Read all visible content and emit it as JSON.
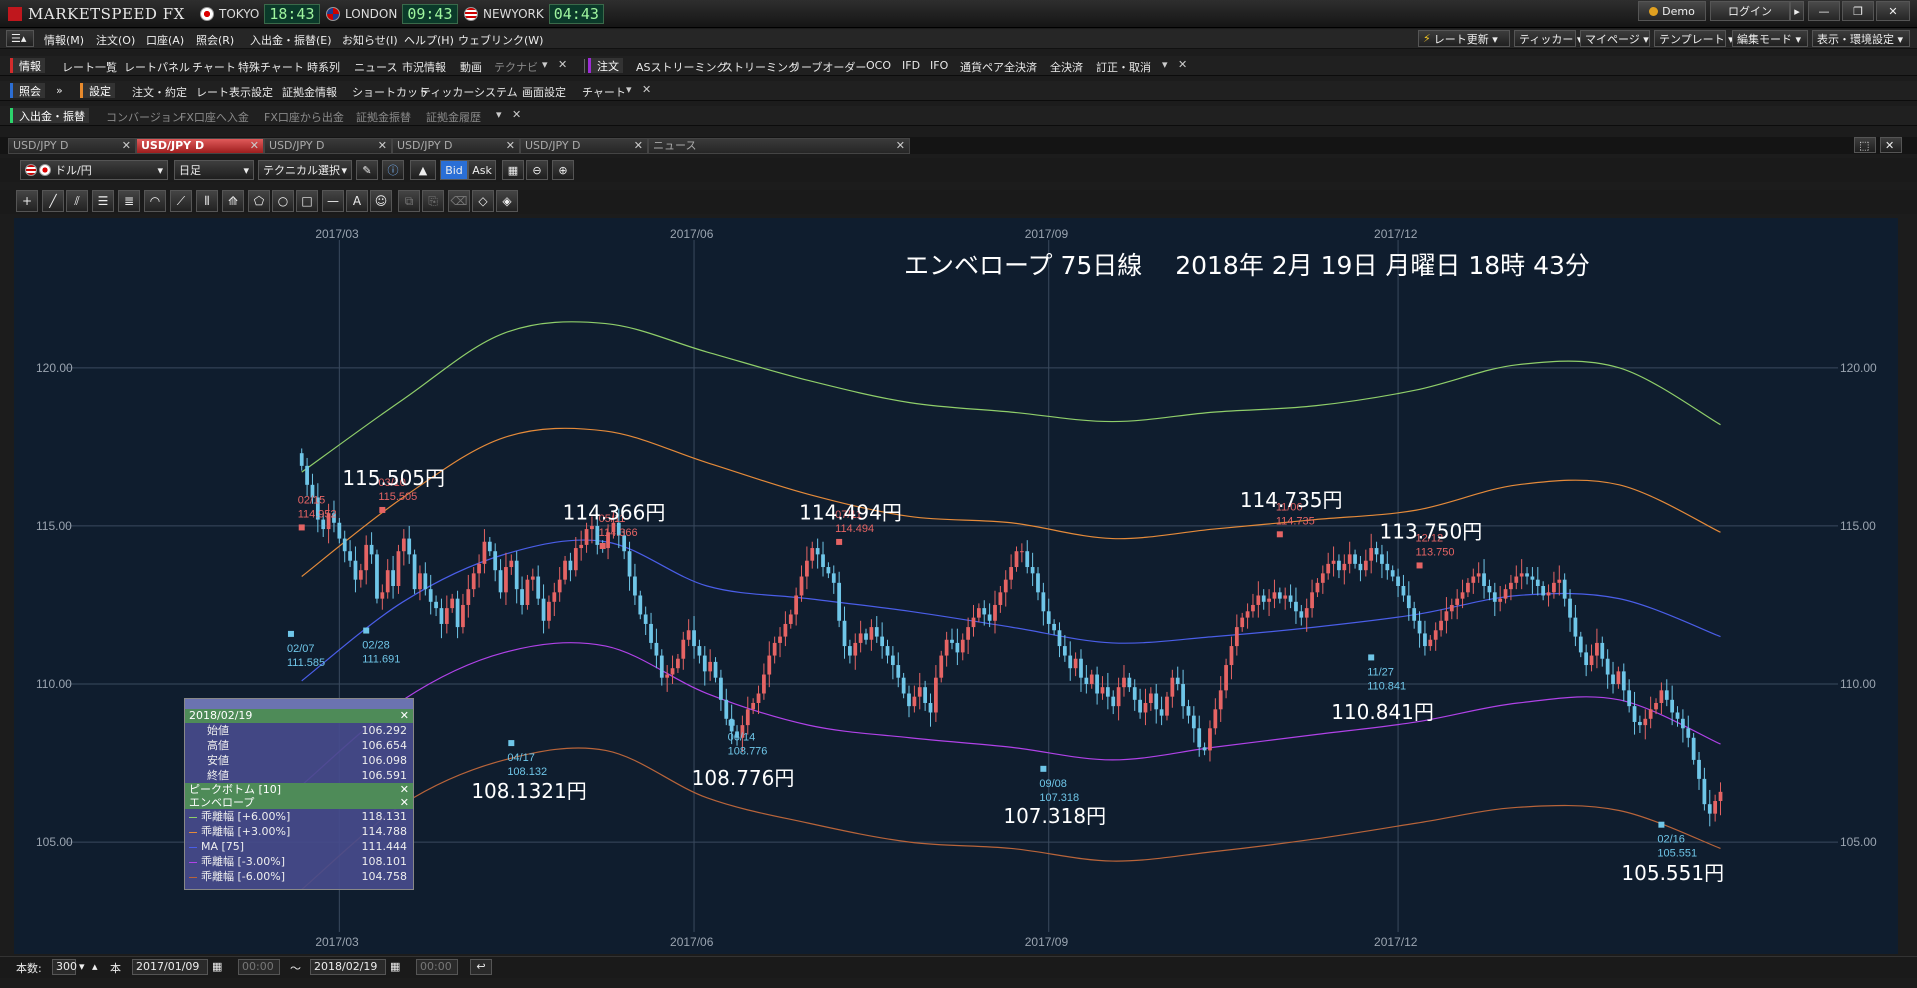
{
  "app": {
    "title": "MARKETSPEED FX"
  },
  "clocks": [
    {
      "city": "TOKYO",
      "time": "18:43"
    },
    {
      "city": "LONDON",
      "time": "09:43"
    },
    {
      "city": "NEWYORK",
      "time": "04:43"
    }
  ],
  "window_buttons": {
    "demo": "Demo",
    "login": "ログイン",
    "arrow": "▸",
    "minimize": "—",
    "restore": "❐",
    "close": "✕"
  },
  "menu": {
    "items": [
      "情報(M)",
      "注文(O)",
      "口座(A)",
      "照会(R)",
      "入出金・振替(E)",
      "お知らせ(I)",
      "ヘルプ(H)",
      "ウェブリンク(W)"
    ],
    "right": [
      "レート更新 ▾",
      "ティッカー ▾",
      "マイページ ▾",
      "テンプレート ▾",
      "編集モード ▾",
      "表示・環境設定 ▾"
    ]
  },
  "toolbar_info": {
    "tag": "情報",
    "items": [
      "レート一覧",
      "レートパネル",
      "チャート",
      "特殊チャート",
      "時系列",
      "ニュース",
      "市況情報",
      "動画",
      "テクナビ"
    ]
  },
  "toolbar_order": {
    "tag": "注文",
    "items": [
      "ASストリーミング",
      "ストリーミング",
      "リーブオーダー",
      "OCO",
      "IFD",
      "IFO",
      "通貨ペア全決済",
      "全決済",
      "訂正・取消"
    ]
  },
  "toolbar_inquiry": {
    "tag": "照会"
  },
  "toolbar_settings": {
    "tag": "設定",
    "items": [
      "注文・約定",
      "レート表示設定",
      "証拠金情報",
      "ショートカット",
      "ティッカー",
      "システム",
      "画面設定",
      "チャート"
    ]
  },
  "toolbar_deposit": {
    "tag": "入出金・振替",
    "items": [
      "コンバージョン",
      "FX口座へ入金",
      "FX口座から出金",
      "証拠金振替",
      "証拠金履歴"
    ]
  },
  "tabs": [
    "USD/JPY D",
    "USD/JPY D",
    "USD/JPY D",
    "USD/JPY D",
    "USD/JPY D",
    "ニュース"
  ],
  "chart_toolbar": {
    "pair": "ドル/円",
    "period": "日足",
    "technical": "テクニカル選択",
    "bid": "Bid",
    "ask": "Ask"
  },
  "info_panel": {
    "date": "2018/02/19",
    "ohlc": [
      {
        "label": "始値",
        "value": "106.292"
      },
      {
        "label": "高値",
        "value": "106.654"
      },
      {
        "label": "安値",
        "value": "106.098"
      },
      {
        "label": "終値",
        "value": "106.591"
      }
    ],
    "section1": "ピークボトム [10]",
    "section2": "エンベロープ",
    "lines": [
      {
        "label": "乖離幅 [+6.00%]",
        "value": "118.131",
        "color": "#8fce6a"
      },
      {
        "label": "乖離幅 [+3.00%]",
        "value": "114.788",
        "color": "#e48a3a"
      },
      {
        "label": "MA [75]",
        "value": "111.444",
        "color": "#4a5ee8"
      },
      {
        "label": "乖離幅 [-3.00%]",
        "value": "108.101",
        "color": "#b042e8"
      },
      {
        "label": "乖離幅 [-6.00%]",
        "value": "104.758",
        "color": "#b8643a"
      }
    ]
  },
  "bottom": {
    "count_label": "本数:",
    "count": "300",
    "unit": "本",
    "from_date": "2017/01/09",
    "from_time": "00:00",
    "tilde": "～",
    "to_date": "2018/02/19",
    "to_time": "00:00"
  },
  "chart_data": {
    "type": "candlestick",
    "title": "エンベロープ 75日線　 2018年 2月 19日 月曜日 18時 43分",
    "x_ticks": [
      {
        "label": "2017/03",
        "x": 7
      },
      {
        "label": "2017/06",
        "x": 73
      },
      {
        "label": "2017/09",
        "x": 139
      },
      {
        "label": "2017/12",
        "x": 204
      }
    ],
    "y_ticks": [
      "120.00",
      "115.00",
      "110.00",
      "105.00"
    ],
    "ylim": [
      102.6,
      123.6
    ],
    "xlim": [
      -42,
      284
    ],
    "close": [
      116.9,
      116.3,
      115.9,
      115.2,
      114.9,
      115.4,
      115.1,
      114.6,
      114.2,
      113.9,
      113.3,
      113.6,
      114.4,
      114.1,
      112.7,
      112.9,
      113.6,
      113.1,
      114.2,
      114.6,
      114.1,
      113.0,
      113.5,
      113.0,
      112.6,
      112.4,
      111.9,
      112.4,
      112.7,
      111.8,
      112.5,
      113.0,
      113.5,
      113.8,
      114.5,
      114.2,
      113.6,
      112.9,
      113.7,
      113.9,
      113.0,
      112.5,
      113.3,
      113.4,
      112.7,
      112.0,
      112.6,
      112.9,
      113.3,
      113.9,
      113.6,
      114.3,
      114.4,
      114.9,
      115.0,
      114.4,
      114.3,
      114.8,
      115.1,
      114.7,
      114.2,
      113.4,
      112.8,
      112.2,
      111.9,
      111.3,
      110.9,
      110.2,
      110.3,
      110.5,
      110.8,
      111.4,
      111.7,
      111.2,
      110.9,
      110.4,
      110.7,
      110.2,
      109.5,
      108.9,
      108.5,
      108.3,
      108.7,
      109.2,
      109.4,
      109.7,
      110.3,
      110.9,
      111.3,
      111.5,
      111.9,
      112.2,
      112.8,
      113.4,
      113.9,
      114.3,
      114.1,
      113.7,
      113.5,
      113.2,
      112.0,
      111.2,
      110.9,
      111.3,
      111.6,
      111.4,
      111.8,
      111.5,
      111.2,
      110.9,
      110.6,
      110.2,
      109.7,
      109.3,
      109.6,
      109.9,
      109.4,
      109.1,
      110.2,
      110.9,
      111.4,
      111.3,
      111.0,
      111.4,
      111.8,
      112.1,
      112.4,
      112.2,
      112.0,
      112.5,
      112.9,
      113.3,
      113.7,
      114.2,
      114.2,
      113.7,
      113.5,
      112.9,
      112.3,
      111.9,
      111.7,
      111.2,
      110.9,
      110.5,
      110.8,
      110.2,
      110.0,
      110.3,
      109.7,
      109.9,
      109.6,
      109.3,
      109.9,
      110.2,
      109.9,
      109.5,
      109.1,
      109.4,
      109.7,
      109.2,
      109.0,
      109.6,
      110.2,
      110.0,
      109.3,
      109.0,
      108.6,
      108.0,
      107.9,
      108.6,
      109.2,
      109.8,
      110.6,
      111.2,
      111.8,
      112.1,
      112.3,
      112.5,
      112.8,
      112.6,
      112.7,
      112.9,
      112.7,
      112.8,
      112.6,
      112.3,
      112.1,
      112.4,
      112.9,
      113.2,
      113.5,
      113.8,
      113.9,
      113.6,
      113.8,
      114.1,
      113.8,
      113.6,
      113.9,
      114.3,
      114.1,
      113.8,
      113.6,
      113.4,
      113.1,
      112.8,
      112.4,
      112.0,
      111.6,
      111.2,
      111.4,
      111.7,
      112.0,
      112.3,
      112.5,
      112.7,
      112.9,
      113.2,
      113.4,
      113.5,
      113.1,
      112.9,
      112.6,
      112.7,
      113.0,
      113.2,
      113.4,
      113.5,
      113.4,
      113.3,
      113.1,
      112.8,
      112.9,
      113.2,
      113.3,
      112.7,
      112.1,
      111.5,
      111.0,
      110.6,
      110.9,
      111.3,
      110.8,
      110.3,
      110.0,
      110.4,
      109.8,
      109.3,
      108.8,
      108.7,
      108.9,
      109.2,
      109.4,
      109.8,
      109.5,
      109.1,
      108.9,
      108.6,
      108.3,
      107.6,
      107.0,
      106.2,
      105.9,
      106.3,
      106.59
    ],
    "peaks": [
      {
        "x": 0,
        "value": 114.952,
        "date": "02/15"
      },
      {
        "x": 15,
        "value": 115.505,
        "date": "03/10"
      },
      {
        "x": 56,
        "value": 114.366,
        "date": "05/11"
      },
      {
        "x": 100,
        "value": 114.494,
        "date": "07/11"
      },
      {
        "x": 182,
        "value": 114.735,
        "date": "11/06"
      },
      {
        "x": 208,
        "value": 113.75,
        "date": "12/12"
      }
    ],
    "bottoms": [
      {
        "x": -2,
        "value": 111.585,
        "date": "02/07"
      },
      {
        "x": 12,
        "value": 111.691,
        "date": "02/28"
      },
      {
        "x": 39,
        "value": 108.132,
        "date": "04/17"
      },
      {
        "x": 80,
        "value": 108.776,
        "date": "06/14"
      },
      {
        "x": 138,
        "value": 107.318,
        "date": "09/08"
      },
      {
        "x": 199,
        "value": 110.841,
        "date": "11/27"
      },
      {
        "x": 253,
        "value": 105.551,
        "date": "02/16"
      }
    ],
    "annotations": [
      {
        "text": "115.505円",
        "x": 15,
        "y": 116.3
      },
      {
        "text": "114.366円",
        "x": 56,
        "y": 115.2
      },
      {
        "text": "114.494円",
        "x": 100,
        "y": 115.2
      },
      {
        "text": "114.735円",
        "x": 182,
        "y": 115.6
      },
      {
        "text": "113.750円",
        "x": 208,
        "y": 114.6
      },
      {
        "text": "108.1321円",
        "x": 39,
        "y": 106.4
      },
      {
        "text": "108.776円",
        "x": 80,
        "y": 106.8
      },
      {
        "text": "107.318円",
        "x": 138,
        "y": 105.6
      },
      {
        "text": "110.841円",
        "x": 199,
        "y": 108.9
      },
      {
        "text": "105.551円",
        "x": 253,
        "y": 103.8
      }
    ],
    "envelopes": [
      {
        "name": "乖離幅 [+6.00%]",
        "color": "#8fce6a",
        "values": [
          116.7,
          119.0,
          121.1,
          121.4,
          120.5,
          119.6,
          118.9,
          118.6,
          118.3,
          118.6,
          118.8,
          119.3,
          120.1,
          120.0,
          118.2
        ]
      },
      {
        "name": "乖離幅 [+3.00%]",
        "color": "#e48a3a",
        "values": [
          113.4,
          115.9,
          117.8,
          118.0,
          117.0,
          116.0,
          115.3,
          115.1,
          114.6,
          114.9,
          115.2,
          115.5,
          116.3,
          116.3,
          114.8
        ]
      },
      {
        "name": "MA [75]",
        "color": "#4a5ee8",
        "values": [
          110.1,
          112.6,
          114.1,
          114.5,
          113.1,
          112.7,
          112.3,
          111.8,
          111.3,
          111.5,
          111.8,
          112.2,
          112.8,
          112.7,
          111.5
        ]
      },
      {
        "name": "乖離幅 [-3.00%]",
        "color": "#b042e8",
        "values": [
          106.8,
          109.5,
          111.0,
          111.2,
          109.7,
          108.7,
          108.3,
          108.0,
          107.6,
          108.0,
          108.4,
          108.8,
          109.4,
          109.5,
          108.1
        ]
      },
      {
        "name": "乖離幅 [-6.00%]",
        "color": "#b8643a",
        "values": [
          103.5,
          106.2,
          107.6,
          107.9,
          106.4,
          105.6,
          105.0,
          104.8,
          104.4,
          104.7,
          105.1,
          105.6,
          106.1,
          106.0,
          104.8
        ]
      }
    ],
    "bull_color": "#e56464",
    "bear_color": "#6fc6e8",
    "grid": true
  }
}
